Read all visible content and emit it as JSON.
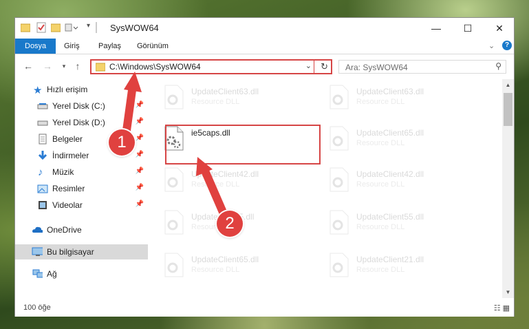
{
  "window": {
    "title": "SysWOW64",
    "controls": {
      "minimize": "—",
      "maximize": "☐",
      "close": "✕"
    }
  },
  "ribbon": {
    "tabs": [
      {
        "label": "Dosya",
        "active": true
      },
      {
        "label": "Giriş"
      },
      {
        "label": "Paylaş"
      },
      {
        "label": "Görünüm"
      }
    ],
    "collapse": "⌄",
    "help": "?"
  },
  "address": {
    "path": "C:\\Windows\\SysWOW64",
    "search_placeholder": "Ara: SysWOW64"
  },
  "nav": {
    "items": [
      {
        "label": "Hızlı erişim",
        "icon": "star-icon"
      },
      {
        "label": "Yerel Disk (C:)",
        "icon": "drive-icon",
        "pinned": true
      },
      {
        "label": "Yerel Disk (D:)",
        "icon": "drive-icon",
        "pinned": true
      },
      {
        "label": "Belgeler",
        "icon": "documents-icon",
        "pinned": true
      },
      {
        "label": "İndirmeler",
        "icon": "download-icon",
        "pinned": true
      },
      {
        "label": "Müzik",
        "icon": "music-icon",
        "pinned": true
      },
      {
        "label": "Resimler",
        "icon": "pictures-icon",
        "pinned": true
      },
      {
        "label": "Videolar",
        "icon": "videos-icon",
        "pinned": true
      },
      {
        "label": "OneDrive",
        "icon": "cloud-icon"
      },
      {
        "label": "Bu bilgisayar",
        "icon": "computer-icon",
        "selected": true
      },
      {
        "label": "Ağ",
        "icon": "network-icon"
      }
    ]
  },
  "files": {
    "highlighted": {
      "name": "ie5caps.dll"
    },
    "left_column": [
      {
        "name": "UpdateClient63.dll",
        "desc": "Resource DLL"
      },
      {
        "name": "UpdateClient42.dll",
        "desc": "Resource DLL"
      },
      {
        "name": "UpdateClient5.dll",
        "desc": "Resource DLL"
      },
      {
        "name": "UpdateClient65.dll",
        "desc": "Resource DLL"
      }
    ],
    "right_column": [
      {
        "name": "UpdateClient63.dll",
        "desc": "Resource DLL"
      },
      {
        "name": "UpdateClient65.dll",
        "desc": "Resource DLL"
      },
      {
        "name": "UpdateClient42.dll",
        "desc": "Resource DLL"
      },
      {
        "name": "UpdateClient55.dll",
        "desc": "Resource DLL"
      },
      {
        "name": "UpdateClient21.dll",
        "desc": "Resource DLL"
      }
    ]
  },
  "status": {
    "count": "100 öğe"
  },
  "annotations": {
    "step1": "1",
    "step2": "2",
    "color": "#e0413f"
  }
}
